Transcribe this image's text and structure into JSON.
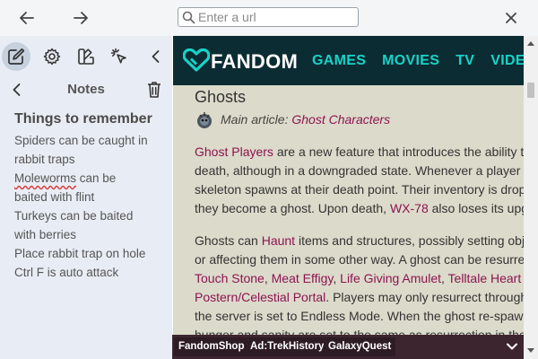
{
  "browser": {
    "url_placeholder": "Enter a url"
  },
  "sidebar": {
    "tools": [
      "notes",
      "settings",
      "customize",
      "select"
    ],
    "notes_title": "Notes",
    "notes": {
      "heading": "Things to remember",
      "lines": [
        "Spiders can be caught in",
        "rabbit traps",
        "can be",
        "baited with flint",
        "Turkeys can be baited",
        "with berries",
        "Place rabbit trap on hole",
        "Ctrl F is auto attack"
      ],
      "misspelled_word": "Moleworms"
    }
  },
  "fandom": {
    "logo_text": "FANDOM",
    "nav": [
      "GAMES",
      "MOVIES",
      "TV",
      "VIDEO"
    ]
  },
  "article": {
    "heading": "Ghosts",
    "main_article_label": "Main article: ",
    "main_article_link": "Ghost Characters",
    "para1": {
      "link_ghost_players": "Ghost Players",
      "l1": " are a new feature that introduces the ability t",
      "l2": "death, although in a downgraded state. Whenever a player",
      "l3": "skeleton spawns at their death point. Their inventory is drop",
      "l4a": "they become a ghost. Upon death, ",
      "link_wx78": "WX-78",
      "l4b": " also loses its upg"
    },
    "para2": {
      "l1a": "Ghosts can ",
      "link_haunt": "Haunt",
      "l1b": " items and structures, possibly setting obj",
      "l2": "or affecting them in some other way. A ghost can be resurre",
      "link_touch_stone": "Touch Stone",
      "link_meat_effigy": "Meat Effigy",
      "link_life_giving_amulet": "Life Giving Amulet",
      "link_telltale_heart": "Telltale Heart",
      "sep": ", ",
      "link_portal": "Postern/Celestial Portal",
      "l4b": ". Players may only resurrect through",
      "l5": "the server is set to Endless Mode. When the ghost re-spaw",
      "l6": "hunger and sanity are set to the same as resurrection in the"
    }
  },
  "bottom_bar": {
    "chips": [
      "FandomShop",
      "Ad:TrekHistory",
      "GalaxyQuest"
    ]
  },
  "colors": {
    "topbar_bg": "#f4f5f6",
    "sidebar_bg": "#e8edf5",
    "fandom_bar_bg": "#0c2c33",
    "nav_accent": "#18d3c8",
    "link": "#8b1450",
    "page_bg": "#dcdacb",
    "bottom_bar_bg": "#3d2530"
  }
}
